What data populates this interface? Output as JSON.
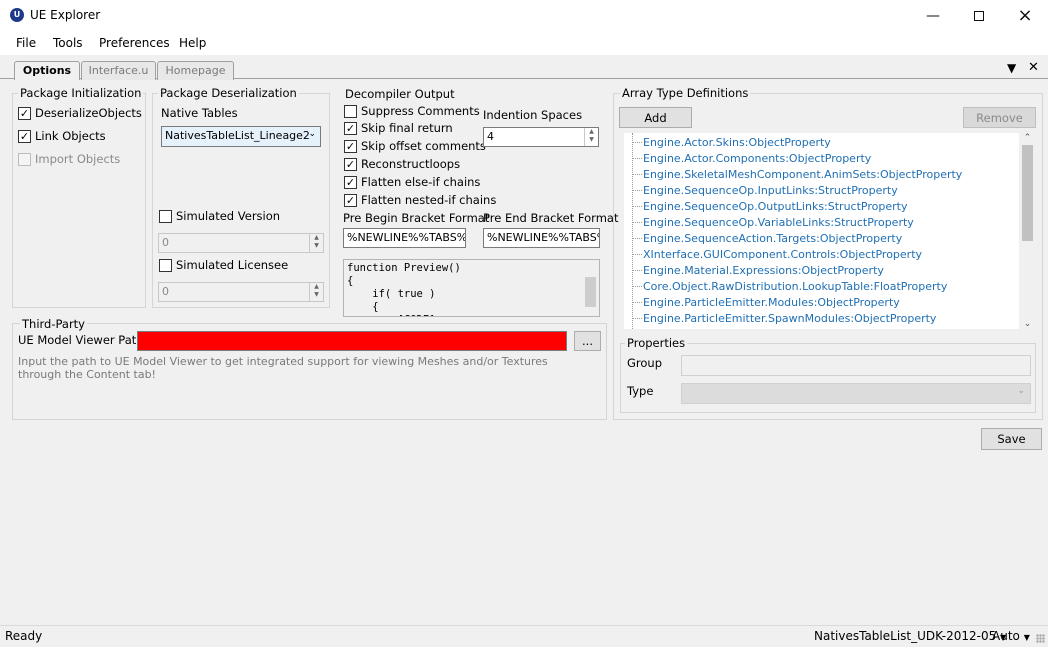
{
  "window": {
    "title": "UE Explorer",
    "icon_text": "U"
  },
  "menu": [
    "File",
    "Tools",
    "Preferences",
    "Help"
  ],
  "tabs": [
    "Options",
    "Interface.u",
    "Homepage"
  ],
  "package_init": {
    "legend": "Package Initialization",
    "deserialize": "DeserializeObjects",
    "link": "Link Objects",
    "import": "Import Objects"
  },
  "package_deser": {
    "legend": "Package Deserialization",
    "native_tables_label": "Native Tables",
    "native_tables_value": "NativesTableList_Lineage2",
    "simulated_version": "Simulated Version",
    "simulated_version_value": "0",
    "simulated_licensee": "Simulated Licensee",
    "simulated_licensee_value": "0"
  },
  "decompiler": {
    "legend": "Decompiler Output",
    "options": [
      "Suppress Comments",
      "Skip final return",
      "Skip offset comments",
      "Reconstructloops",
      "Flatten else-if chains",
      "Flatten nested-if chains"
    ],
    "checked": [
      false,
      true,
      true,
      true,
      true,
      true
    ],
    "indention_label": "Indention Spaces",
    "indention_value": "4",
    "pre_begin_label": "Pre Begin Bracket Format",
    "pre_begin_value": "%NEWLINE%%TABS%",
    "pre_end_label": "Pre End Bracket Format",
    "pre_end_value": "%NEWLINE%%TABS%",
    "preview_lines": [
      "function Preview()",
      "{",
      "    if( true )",
      "    {",
      "        [CODE]"
    ]
  },
  "third_party": {
    "legend": "Third-Party",
    "path_label": "UE Model Viewer Path",
    "path_value": "",
    "browse": "...",
    "hint": "Input the path to UE Model Viewer to get integrated support for viewing Meshes and/or Textures through the Content tab!",
    "path_color": "#ff0000"
  },
  "array_defs": {
    "legend": "Array Type Definitions",
    "add": "Add",
    "remove": "Remove",
    "items": [
      "Engine.Actor.Skins:ObjectProperty",
      "Engine.Actor.Components:ObjectProperty",
      "Engine.SkeletalMeshComponent.AnimSets:ObjectProperty",
      "Engine.SequenceOp.InputLinks:StructProperty",
      "Engine.SequenceOp.OutputLinks:StructProperty",
      "Engine.SequenceOp.VariableLinks:StructProperty",
      "Engine.SequenceAction.Targets:ObjectProperty",
      "XInterface.GUIComponent.Controls:ObjectProperty",
      "Engine.Material.Expressions:ObjectProperty",
      "Core.Object.RawDistribution.LookupTable:FloatProperty",
      "Engine.ParticleEmitter.Modules:ObjectProperty",
      "Engine.ParticleEmitter.SpawnModules:ObjectProperty"
    ],
    "item_color": "#1f6fb3",
    "properties_legend": "Properties",
    "group_label": "Group",
    "type_label": "Type"
  },
  "save": "Save",
  "status": {
    "text": "Ready",
    "table": "NativesTableList_UDK-2012-05",
    "mode": "Auto"
  }
}
